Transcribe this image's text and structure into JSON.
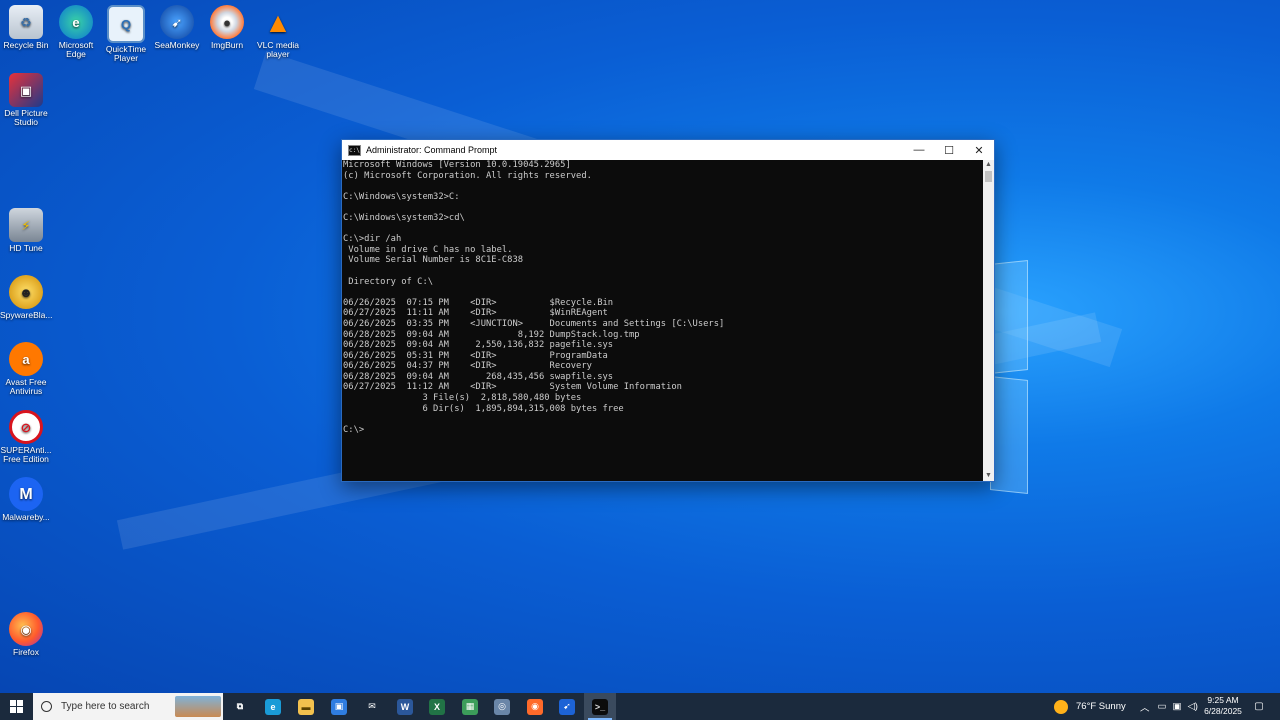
{
  "desktop_icons": [
    {
      "label": "Recycle Bin"
    },
    {
      "label": "Microsoft Edge"
    },
    {
      "label": "QuickTime Player"
    },
    {
      "label": "SeaMonkey"
    },
    {
      "label": "ImgBurn"
    },
    {
      "label": "VLC media player"
    },
    {
      "label": "Dell Picture Studio"
    },
    {
      "label": "HD Tune"
    },
    {
      "label": "SpywareBla..."
    },
    {
      "label": "Avast Free Antivirus"
    },
    {
      "label": "SUPERAnti... Free Edition"
    },
    {
      "label": "Malwareby..."
    },
    {
      "label": "Firefox"
    }
  ],
  "cmd": {
    "title": "Administrator: Command Prompt",
    "minimize_glyph": "—",
    "maximize_glyph": "☐",
    "close_glyph": "✕",
    "lines": [
      "Microsoft Windows [Version 10.0.19045.2965]",
      "(c) Microsoft Corporation. All rights reserved.",
      "",
      "C:\\Windows\\system32>C:",
      "",
      "C:\\Windows\\system32>cd\\",
      "",
      "C:\\>dir /ah",
      " Volume in drive C has no label.",
      " Volume Serial Number is 8C1E-C838",
      "",
      " Directory of C:\\",
      "",
      "06/26/2025  07:15 PM    <DIR>          $Recycle.Bin",
      "06/27/2025  11:11 AM    <DIR>          $WinREAgent",
      "06/26/2025  03:35 PM    <JUNCTION>     Documents and Settings [C:\\Users]",
      "06/28/2025  09:04 AM             8,192 DumpStack.log.tmp",
      "06/28/2025  09:04 AM     2,550,136,832 pagefile.sys",
      "06/26/2025  05:31 PM    <DIR>          ProgramData",
      "06/26/2025  04:37 PM    <DIR>          Recovery",
      "06/28/2025  09:04 AM       268,435,456 swapfile.sys",
      "06/27/2025  11:12 AM    <DIR>          System Volume Information",
      "               3 File(s)  2,818,580,480 bytes",
      "               6 Dir(s)  1,895,894,315,008 bytes free",
      "",
      "C:\\>"
    ]
  },
  "taskbar": {
    "search_placeholder": "Type here to search",
    "weather": "76°F  Sunny",
    "time": "9:25 AM",
    "date": "6/28/2025",
    "apps": [
      {
        "name": "task-view",
        "glyph": "⧉"
      },
      {
        "name": "edge",
        "glyph": "e"
      },
      {
        "name": "file-explorer",
        "glyph": "▬"
      },
      {
        "name": "store",
        "glyph": "▣"
      },
      {
        "name": "mail",
        "glyph": "✉"
      },
      {
        "name": "word",
        "glyph": "W"
      },
      {
        "name": "excel",
        "glyph": "X"
      },
      {
        "name": "network-app",
        "glyph": "▦"
      },
      {
        "name": "app-circle",
        "glyph": "◎"
      },
      {
        "name": "firefox",
        "glyph": "◉"
      },
      {
        "name": "seamonkey",
        "glyph": "➹"
      },
      {
        "name": "command-prompt",
        "glyph": ">_"
      }
    ]
  }
}
